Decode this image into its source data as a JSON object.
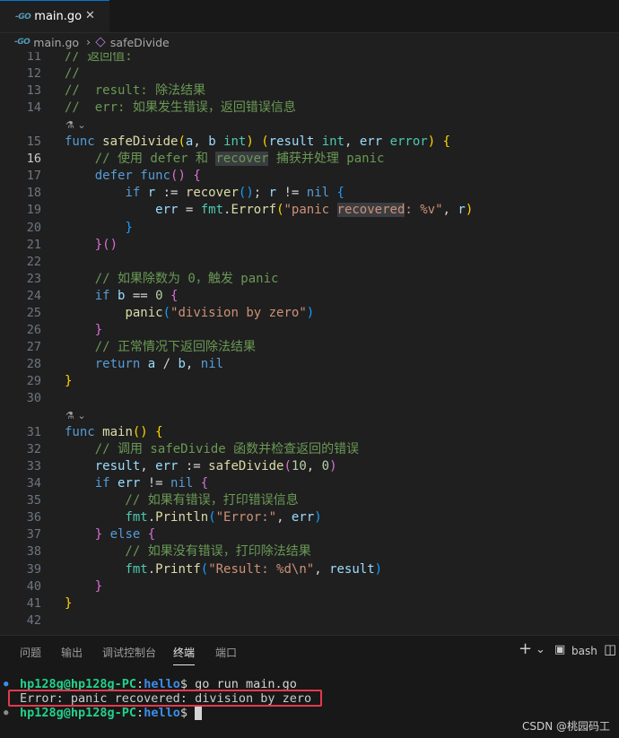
{
  "tab": {
    "badge": "-GO",
    "title": "main.go",
    "close": "✕"
  },
  "breadcrumb": {
    "file": "main.go",
    "symbol": "safeDivide",
    "sep": "›"
  },
  "lens_glyph": "⚗ ⌄",
  "code_lines": [
    {
      "n": "11",
      "segs": [
        [
          "cm",
          "// 返回值:"
        ]
      ]
    },
    {
      "n": "12",
      "segs": [
        [
          "cm",
          "//"
        ]
      ]
    },
    {
      "n": "13",
      "segs": [
        [
          "cm",
          "//  result: 除法结果"
        ]
      ]
    },
    {
      "n": "14",
      "segs": [
        [
          "cm",
          "//  err: 如果发生错误，返回错误信息"
        ]
      ]
    },
    {
      "lens": true
    },
    {
      "n": "15",
      "segs": [
        [
          "kw",
          "func "
        ],
        [
          "fn",
          "safeDivide"
        ],
        [
          "br1",
          "("
        ],
        [
          "vr",
          "a"
        ],
        [
          "pl",
          ", "
        ],
        [
          "vr",
          "b"
        ],
        [
          "pl",
          " "
        ],
        [
          "ty",
          "int"
        ],
        [
          "br1",
          ")"
        ],
        [
          "pl",
          " "
        ],
        [
          "br1",
          "("
        ],
        [
          "vr",
          "result"
        ],
        [
          "pl",
          " "
        ],
        [
          "ty",
          "int"
        ],
        [
          "pl",
          ", "
        ],
        [
          "vr",
          "err"
        ],
        [
          "pl",
          " "
        ],
        [
          "ty",
          "error"
        ],
        [
          "br1",
          ")"
        ],
        [
          "pl",
          " "
        ],
        [
          "br1",
          "{"
        ]
      ]
    },
    {
      "n": "16",
      "cur": true,
      "segs": [
        [
          "cm",
          "    // 使用 defer 和 "
        ],
        [
          "cmhl",
          "recover"
        ],
        [
          "cm",
          " 捕获并处理 panic"
        ]
      ]
    },
    {
      "n": "17",
      "segs": [
        [
          "pl",
          "    "
        ],
        [
          "kw",
          "defer "
        ],
        [
          "kw",
          "func"
        ],
        [
          "br2",
          "()"
        ],
        [
          "pl",
          " "
        ],
        [
          "br2",
          "{"
        ]
      ]
    },
    {
      "n": "18",
      "segs": [
        [
          "pl",
          "        "
        ],
        [
          "kw",
          "if "
        ],
        [
          "vr",
          "r"
        ],
        [
          "pl",
          " := "
        ],
        [
          "fn",
          "recover"
        ],
        [
          "br3",
          "()"
        ],
        [
          "pl",
          "; "
        ],
        [
          "vr",
          "r"
        ],
        [
          "pl",
          " != "
        ],
        [
          "kw",
          "nil"
        ],
        [
          "pl",
          " "
        ],
        [
          "br3",
          "{"
        ]
      ]
    },
    {
      "n": "19",
      "segs": [
        [
          "pl",
          "            "
        ],
        [
          "vr",
          "err"
        ],
        [
          "pl",
          " = "
        ],
        [
          "ty",
          "fmt"
        ],
        [
          "pl",
          "."
        ],
        [
          "fn",
          "Errorf"
        ],
        [
          "br1",
          "("
        ],
        [
          "st",
          "\"panic "
        ],
        [
          "sthl",
          "recovered"
        ],
        [
          "st",
          ": %v\""
        ],
        [
          "pl",
          ", "
        ],
        [
          "vr",
          "r"
        ],
        [
          "br1",
          ")"
        ]
      ]
    },
    {
      "n": "20",
      "segs": [
        [
          "pl",
          "        "
        ],
        [
          "br3",
          "}"
        ]
      ]
    },
    {
      "n": "21",
      "segs": [
        [
          "pl",
          "    "
        ],
        [
          "br2",
          "}()"
        ]
      ]
    },
    {
      "n": "22",
      "segs": []
    },
    {
      "n": "23",
      "segs": [
        [
          "cm",
          "    // 如果除数为 0，触发 panic"
        ]
      ]
    },
    {
      "n": "24",
      "segs": [
        [
          "pl",
          "    "
        ],
        [
          "kw",
          "if "
        ],
        [
          "vr",
          "b"
        ],
        [
          "pl",
          " == "
        ],
        [
          "nm",
          "0"
        ],
        [
          "pl",
          " "
        ],
        [
          "br2",
          "{"
        ]
      ]
    },
    {
      "n": "25",
      "segs": [
        [
          "pl",
          "        "
        ],
        [
          "fn",
          "panic"
        ],
        [
          "br3",
          "("
        ],
        [
          "st",
          "\"division by zero\""
        ],
        [
          "br3",
          ")"
        ]
      ]
    },
    {
      "n": "26",
      "segs": [
        [
          "pl",
          "    "
        ],
        [
          "br2",
          "}"
        ]
      ]
    },
    {
      "n": "27",
      "segs": [
        [
          "cm",
          "    // 正常情况下返回除法结果"
        ]
      ]
    },
    {
      "n": "28",
      "segs": [
        [
          "pl",
          "    "
        ],
        [
          "kw",
          "return "
        ],
        [
          "vr",
          "a"
        ],
        [
          "pl",
          " / "
        ],
        [
          "vr",
          "b"
        ],
        [
          "pl",
          ", "
        ],
        [
          "kw",
          "nil"
        ]
      ]
    },
    {
      "n": "29",
      "segs": [
        [
          "br1",
          "}"
        ]
      ]
    },
    {
      "n": "30",
      "segs": []
    },
    {
      "lens": true
    },
    {
      "n": "31",
      "segs": [
        [
          "kw",
          "func "
        ],
        [
          "fn",
          "main"
        ],
        [
          "br1",
          "()"
        ],
        [
          "pl",
          " "
        ],
        [
          "br1",
          "{"
        ]
      ]
    },
    {
      "n": "32",
      "segs": [
        [
          "cm",
          "    // 调用 safeDivide 函数并检查返回的错误"
        ]
      ]
    },
    {
      "n": "33",
      "segs": [
        [
          "pl",
          "    "
        ],
        [
          "vr",
          "result"
        ],
        [
          "pl",
          ", "
        ],
        [
          "vr",
          "err"
        ],
        [
          "pl",
          " := "
        ],
        [
          "fn",
          "safeDivide"
        ],
        [
          "br2",
          "("
        ],
        [
          "nm",
          "10"
        ],
        [
          "pl",
          ", "
        ],
        [
          "nm",
          "0"
        ],
        [
          "br2",
          ")"
        ]
      ]
    },
    {
      "n": "34",
      "segs": [
        [
          "pl",
          "    "
        ],
        [
          "kw",
          "if "
        ],
        [
          "vr",
          "err"
        ],
        [
          "pl",
          " != "
        ],
        [
          "kw",
          "nil"
        ],
        [
          "pl",
          " "
        ],
        [
          "br2",
          "{"
        ]
      ]
    },
    {
      "n": "35",
      "segs": [
        [
          "cm",
          "        // 如果有错误，打印错误信息"
        ]
      ]
    },
    {
      "n": "36",
      "segs": [
        [
          "pl",
          "        "
        ],
        [
          "ty",
          "fmt"
        ],
        [
          "pl",
          "."
        ],
        [
          "fn",
          "Println"
        ],
        [
          "br3",
          "("
        ],
        [
          "st",
          "\"Error:\""
        ],
        [
          "pl",
          ", "
        ],
        [
          "vr",
          "err"
        ],
        [
          "br3",
          ")"
        ]
      ]
    },
    {
      "n": "37",
      "segs": [
        [
          "pl",
          "    "
        ],
        [
          "br2",
          "}"
        ],
        [
          "pl",
          " "
        ],
        [
          "kw",
          "else "
        ],
        [
          "br2",
          "{"
        ]
      ]
    },
    {
      "n": "38",
      "segs": [
        [
          "cm",
          "        // 如果没有错误，打印除法结果"
        ]
      ]
    },
    {
      "n": "39",
      "segs": [
        [
          "pl",
          "        "
        ],
        [
          "ty",
          "fmt"
        ],
        [
          "pl",
          "."
        ],
        [
          "fn",
          "Printf"
        ],
        [
          "br3",
          "("
        ],
        [
          "st",
          "\"Result: %d\\n\""
        ],
        [
          "pl",
          ", "
        ],
        [
          "vr",
          "result"
        ],
        [
          "br3",
          ")"
        ]
      ]
    },
    {
      "n": "40",
      "segs": [
        [
          "pl",
          "    "
        ],
        [
          "br2",
          "}"
        ]
      ]
    },
    {
      "n": "41",
      "segs": [
        [
          "br1",
          "}"
        ]
      ]
    },
    {
      "n": "42",
      "segs": []
    }
  ],
  "panel": {
    "tabs": [
      "问题",
      "输出",
      "调试控制台",
      "终端",
      "端口"
    ],
    "active_tab": "终端",
    "add": "+",
    "add_menu": "⌄",
    "shell": "bash",
    "split": "◫"
  },
  "terminal": {
    "user": "hp128g@hp128g-PC",
    "dir": "hello",
    "cmd": "go run main.go",
    "output": "Error: panic recovered: division by zero",
    "dot_ok_color": "#3b8eea",
    "dot_idle_color": "#8a8a8a"
  },
  "watermark": "CSDN @桃园码工"
}
